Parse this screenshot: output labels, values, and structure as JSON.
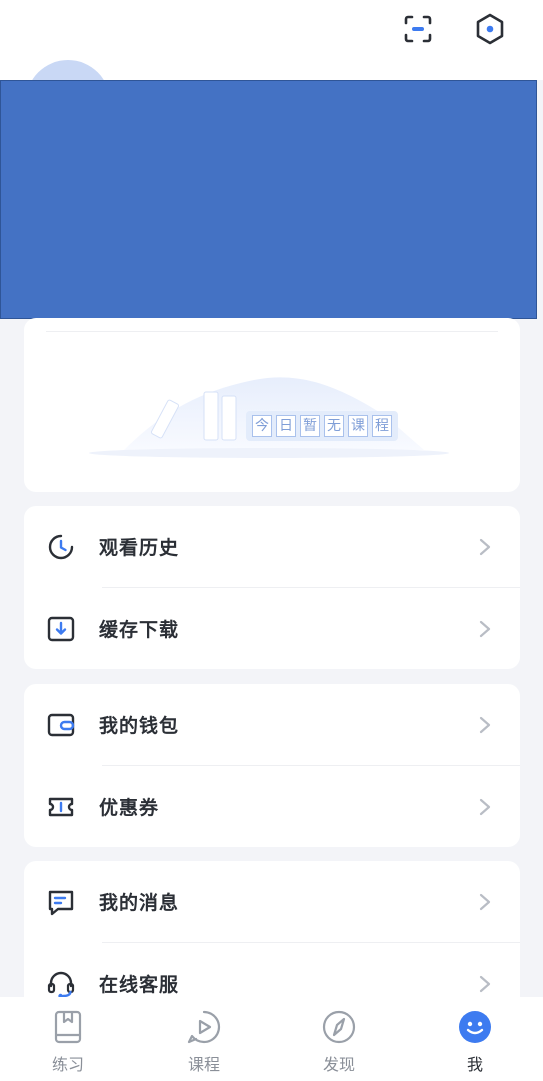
{
  "header": {
    "scan_icon": "scan-icon",
    "settings_icon": "settings-hex-icon"
  },
  "today_card": {
    "empty_chars": [
      "今",
      "日",
      "暂",
      "无",
      "课",
      "程"
    ]
  },
  "menu_groups": [
    {
      "items": [
        {
          "label": "观看历史",
          "icon": "clock-history-icon"
        },
        {
          "label": "缓存下载",
          "icon": "download-icon"
        }
      ]
    },
    {
      "items": [
        {
          "label": "我的钱包",
          "icon": "wallet-icon"
        },
        {
          "label": "优惠券",
          "icon": "coupon-icon"
        }
      ]
    },
    {
      "items": [
        {
          "label": "我的消息",
          "icon": "message-icon"
        },
        {
          "label": "在线客服",
          "icon": "headset-icon"
        }
      ]
    }
  ],
  "tabbar": {
    "tabs": [
      {
        "label": "练习",
        "icon": "book-icon"
      },
      {
        "label": "课程",
        "icon": "play-icon"
      },
      {
        "label": "发现",
        "icon": "compass-icon"
      },
      {
        "label": "我",
        "icon": "profile-icon",
        "active": true
      }
    ]
  },
  "colors": {
    "accent": "#3d7bf0",
    "redaction": "#4472c4",
    "background": "#f3f4f8"
  }
}
